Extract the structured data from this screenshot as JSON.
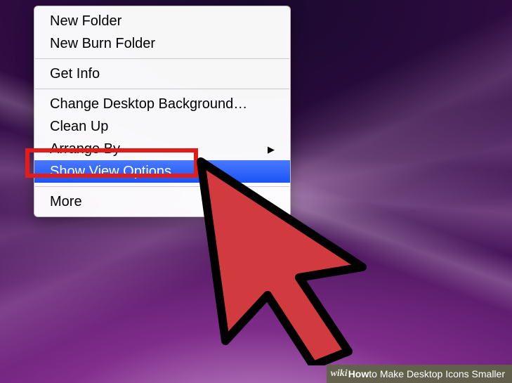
{
  "menu": {
    "items": [
      {
        "label": "New Folder",
        "hasSubmenu": false,
        "highlighted": false
      },
      {
        "label": "New Burn Folder",
        "hasSubmenu": false,
        "highlighted": false
      }
    ],
    "items2": [
      {
        "label": "Get Info",
        "hasSubmenu": false,
        "highlighted": false
      }
    ],
    "items3": [
      {
        "label": "Change Desktop Background…",
        "hasSubmenu": false,
        "highlighted": false
      },
      {
        "label": "Clean Up",
        "hasSubmenu": false,
        "highlighted": false
      },
      {
        "label": "Arrange By",
        "hasSubmenu": true,
        "highlighted": false
      },
      {
        "label": "Show View Options",
        "hasSubmenu": false,
        "highlighted": true
      }
    ],
    "items4": [
      {
        "label": "More",
        "hasSubmenu": false,
        "highlighted": false
      }
    ],
    "submenu_marker": "▶"
  },
  "caption": {
    "brand": "wiki",
    "brandHow": "How",
    "title": " to Make Desktop Icons Smaller"
  },
  "colors": {
    "highlight_box": "#e21b1b",
    "menu_highlight_top": "#4a79ff",
    "menu_highlight_bottom": "#1b53f7",
    "cursor_fill": "#d13a3f",
    "caption_bg": "#5f6446"
  }
}
